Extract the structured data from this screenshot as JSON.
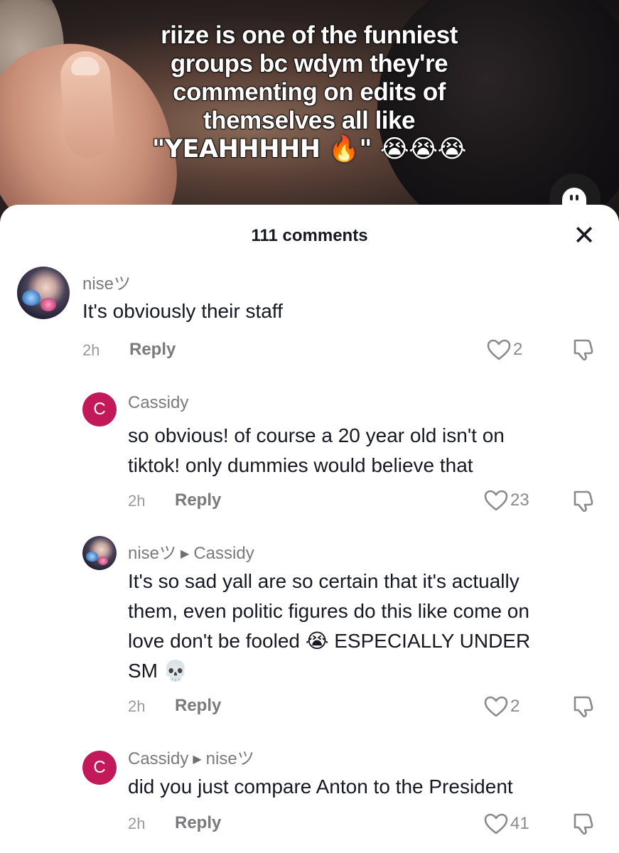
{
  "video": {
    "overlay_lines": [
      "riize is one of the funniest",
      "groups bc wdym they're",
      "commenting on edits of",
      "themselves all like",
      "\"YEAHHHHH 🔥\" 😭😭😭"
    ]
  },
  "sheet": {
    "title": "111 comments",
    "close_label": "✕"
  },
  "comments": [
    {
      "author": "niseツ",
      "reply_to": "",
      "avatar": "photo",
      "text": "It's obviously their staff",
      "time": "2h",
      "reply_label": "Reply",
      "likes": "2"
    },
    {
      "author": "Cassidy",
      "reply_to": "",
      "avatar_letter": "C",
      "text_lines": [
        "so obvious! of course a 20 year old isn't on",
        "tiktok! only dummies would believe that"
      ],
      "time": "2h",
      "reply_label": "Reply",
      "likes": "23"
    },
    {
      "author": "niseツ",
      "reply_to": "Cassidy",
      "avatar": "photo",
      "text_lines": [
        "It's so sad yall are so certain that it's actually",
        "them, even politic figures do this like come on",
        "love don't be fooled 😭 ESPECIALLY UNDER",
        "SM 💀"
      ],
      "time": "2h",
      "reply_label": "Reply",
      "likes": "2"
    },
    {
      "author": "Cassidy",
      "reply_to": "niseツ",
      "avatar_letter": "C",
      "text": "did you just compare Anton to the President",
      "time": "2h",
      "reply_label": "Reply",
      "likes": "41"
    }
  ],
  "icons": {
    "like": "heart-outline-icon",
    "dislike": "thumbs-down-icon",
    "mute": "ghost-icon",
    "reply_arrow": "caret-right-icon"
  },
  "colors": {
    "avatar_letter_bg": "#c2195b",
    "text_primary": "#161823",
    "text_secondary": "#7a7a7e"
  }
}
